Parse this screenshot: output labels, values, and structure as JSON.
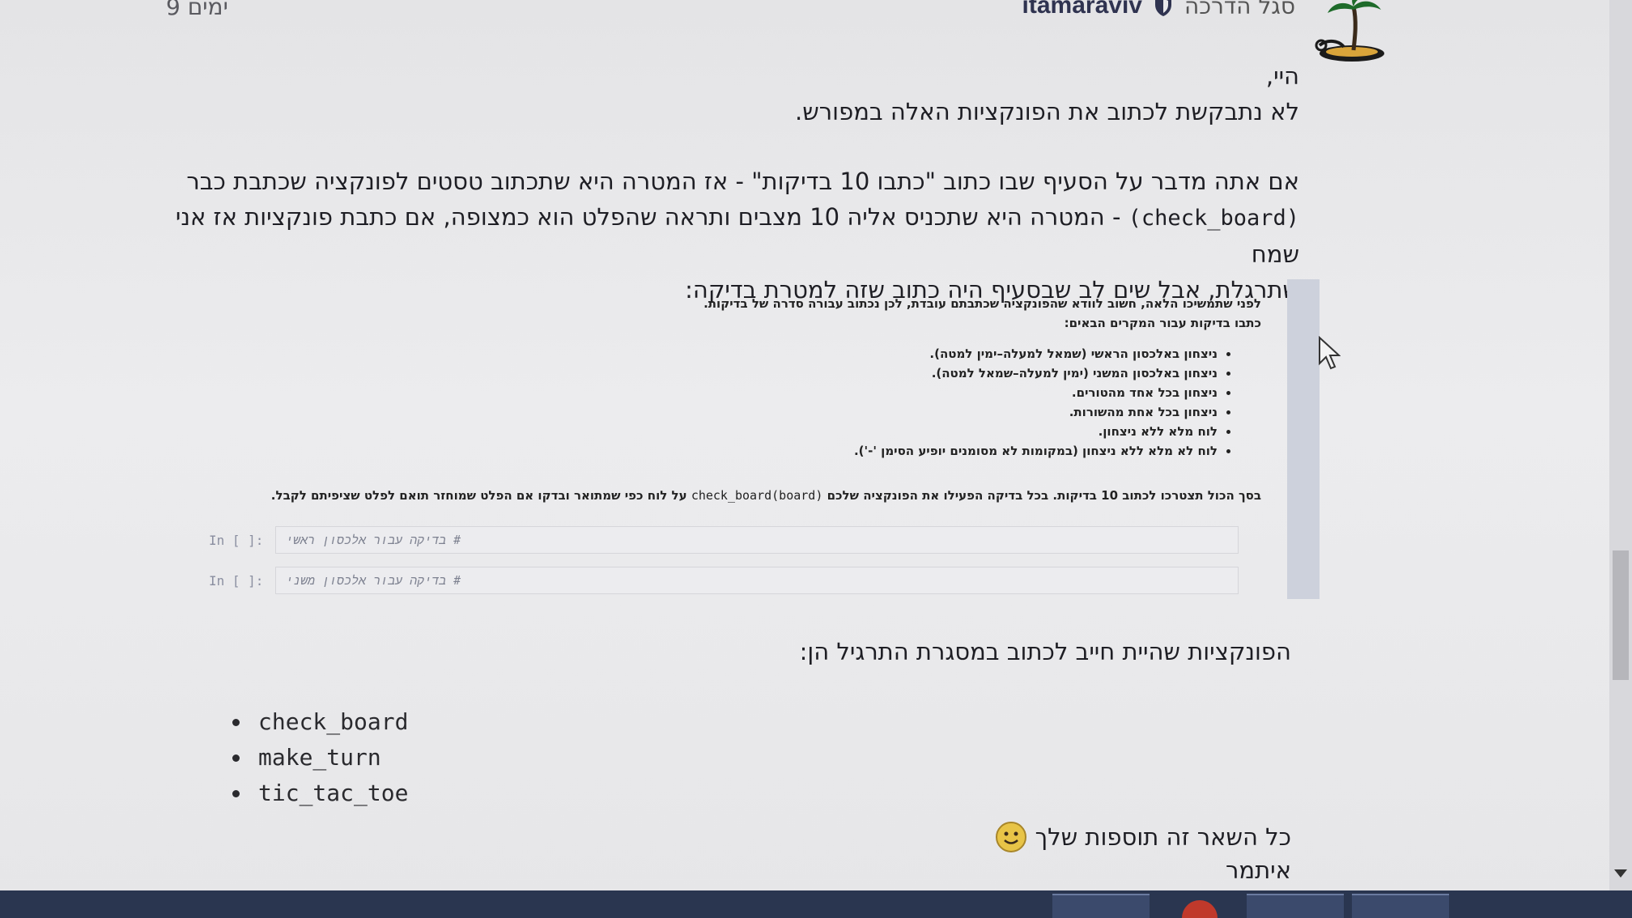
{
  "header": {
    "days_left": "9 ימים",
    "username": "itamaraviv",
    "role": "סגל הדרכה"
  },
  "message": {
    "greeting": "היי,",
    "line1": "לא נתבקשת לכתוב את הפונקציות האלה במפורש.",
    "para2_line1": "אם אתה מדבר על הסעיף שבו כתוב \"כתבו 10 בדיקות\" - אז המטרה היא שתכתוב טסטים לפונקציה שכתבת כבר",
    "para2_line2_code": "(check_board)",
    "para2_line2_text": "- המטרה היא שתכניס אליה 10 מצבים ותראה שהפלט הוא כמצופה, אם כתבת פונקציות אז אני שמח",
    "para2_line3": "שתרגלת, אבל שים לב שבסעיף היה כתוב שזה למטרת בדיקה:"
  },
  "notebook": {
    "intro_line1": "לפני שתמשיכו הלאה, חשוב לוודא שהפונקציה שכתבתם עובדת, לכן נכתוב עבורה סדרה של בדיקות.",
    "intro_line2": "כתבו בדיקות עבור המקרים הבאים:",
    "cases": [
      "ניצחון באלכסון הראשי (שמאל למעלה–ימין למטה).",
      "ניצחון באלכסון המשני (ימין למעלה–שמאל למטה).",
      "ניצחון בכל אחד מהטורים.",
      "ניצחון בכל אחת מהשורות.",
      "לוח מלא ללא ניצחון.",
      "לוח לא מלא ללא ניצחון (במקומות לא מסומנים יופיע הסימן '-')."
    ],
    "summary_prefix": "בסך הכול תצטרכו לכתוב 10 בדיקות. בכל בדיקה הפעילו את הפונקציה שלכם",
    "summary_code": "check_board(board)",
    "summary_suffix": "על לוח כפי שמתואר ובדקו אם הפלט שמוחזר תואם לפלט שציפיתם לקבל.",
    "cells": [
      {
        "prompt": "In [ ]:",
        "comment": "# בדיקה עבור אלכסון ראשי"
      },
      {
        "prompt": "In [ ]:",
        "comment": "# בדיקה עבור אלכסון משני"
      }
    ]
  },
  "functions": {
    "heading": "הפונקציות שהיית חייב לכתוב במסגרת התרגיל הן:",
    "items": [
      "check_board",
      "make_turn",
      "tic_tac_toe"
    ]
  },
  "closing": {
    "text": "כל השאר זה תוספות שלך",
    "signature": "איתמר"
  },
  "icons": {
    "avatar": "palm-tree-island-icon",
    "badge": "shield-icon",
    "smiley": "smiley-icon",
    "cursor": "mouse-cursor-icon"
  },
  "colors": {
    "background": "#e8e8ea",
    "username": "#2f3350",
    "notebook_sidebar": "#cdd1dc",
    "taskbar": "#2a3650"
  }
}
